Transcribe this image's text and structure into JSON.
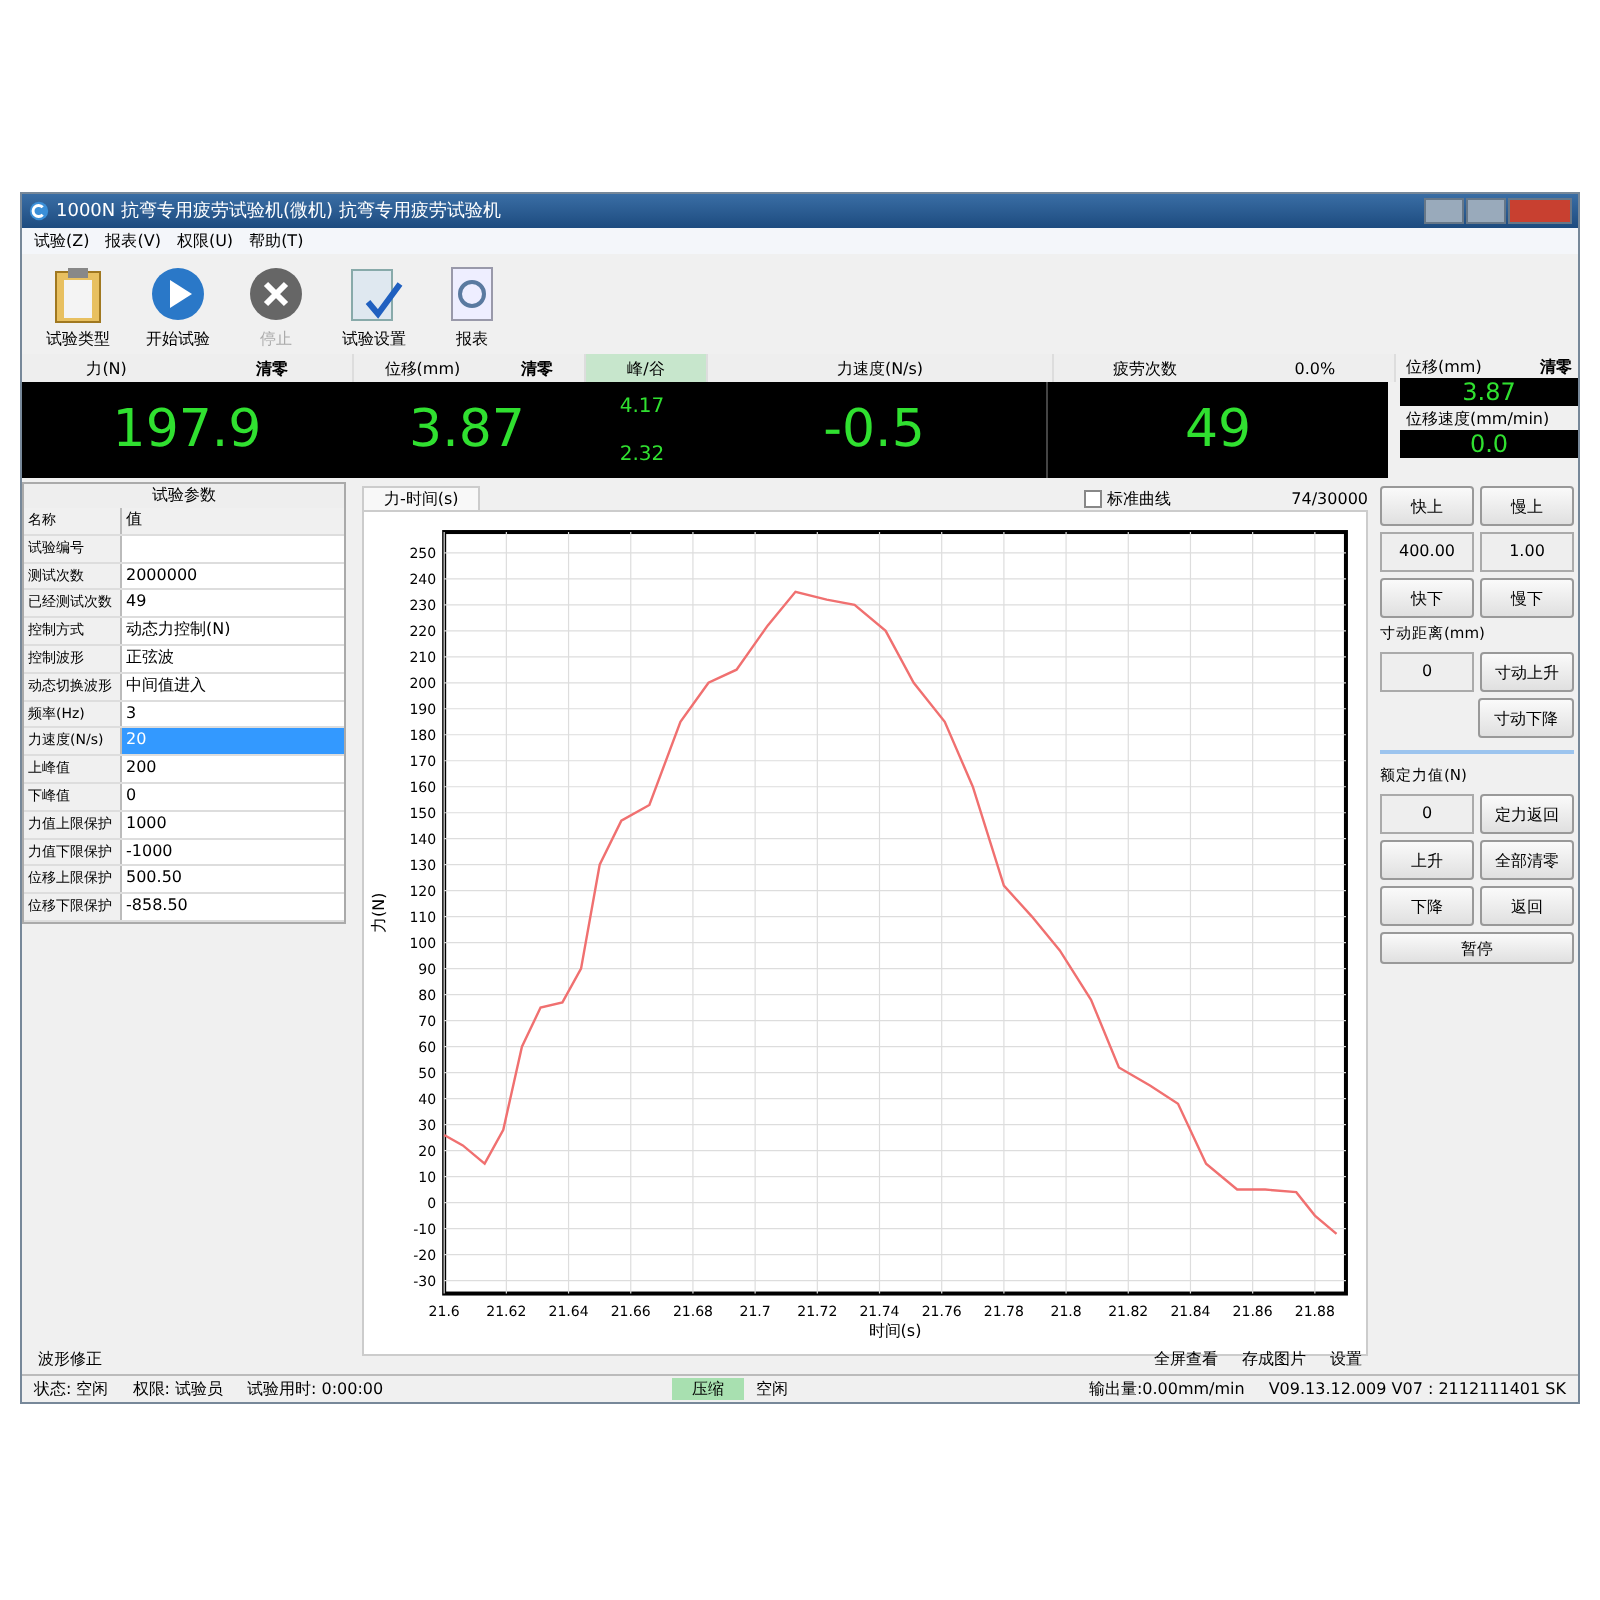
{
  "window": {
    "title": "1000N 抗弯专用疲劳试验机(微机) 抗弯专用疲劳试验机"
  },
  "menu": [
    "试验(Z)",
    "报表(V)",
    "权限(U)",
    "帮助(T)"
  ],
  "toolbar": [
    {
      "label": "试验类型",
      "kind": "clipboard",
      "disabled": false
    },
    {
      "label": "开始试验",
      "kind": "play",
      "disabled": false
    },
    {
      "label": "停止",
      "kind": "stop",
      "disabled": true
    },
    {
      "label": "试验设置",
      "kind": "settings",
      "disabled": false
    },
    {
      "label": "报表",
      "kind": "report",
      "disabled": false
    }
  ],
  "readouts": [
    {
      "label": "力(N)",
      "action": "清零",
      "value": "197.9"
    },
    {
      "label": "位移(mm)",
      "action": "清零",
      "value": "3.87"
    },
    {
      "label": "峰/谷",
      "peak": "4.17",
      "valley": "2.32"
    },
    {
      "label": "力速度(N/s)",
      "value": "-0.5"
    },
    {
      "label": "疲劳次数",
      "percent": "0.0%",
      "value": "49"
    }
  ],
  "side_readouts": [
    {
      "label": "位移(mm)",
      "action": "清零",
      "value": "3.87"
    },
    {
      "label": "位移速度(mm/min)",
      "value": "0.0"
    }
  ],
  "params": {
    "title": "试验参数",
    "columns": [
      "名称",
      "值"
    ],
    "rows": [
      {
        "name": "试验编号",
        "value": "",
        "selected": false
      },
      {
        "name": "测试次数",
        "value": "2000000",
        "selected": false
      },
      {
        "name": "已经测试次数",
        "value": "49",
        "selected": false
      },
      {
        "name": "控制方式",
        "value": "动态力控制(N)",
        "selected": false
      },
      {
        "name": "控制波形",
        "value": "正弦波",
        "selected": false
      },
      {
        "name": "动态切换波形",
        "value": "中间值进入",
        "selected": false
      },
      {
        "name": "频率(Hz)",
        "value": "3",
        "selected": false
      },
      {
        "name": "力速度(N/s)",
        "value": "20",
        "selected": true
      },
      {
        "name": "上峰值",
        "value": "200",
        "selected": false
      },
      {
        "name": "下峰值",
        "value": "0",
        "selected": false
      },
      {
        "name": "力值上限保护",
        "value": "1000",
        "selected": false
      },
      {
        "name": "力值下限保护",
        "value": "-1000",
        "selected": false
      },
      {
        "name": "位移上限保护",
        "value": "500.50",
        "selected": false
      },
      {
        "name": "位移下限保护",
        "value": "-858.50",
        "selected": false
      }
    ]
  },
  "chart_panel": {
    "tab": "力-时间(s)",
    "standard_curve": {
      "label": "标准曲线",
      "checked": false
    },
    "counter": "74/30000",
    "chart_data": {
      "type": "line",
      "grid": true,
      "xlabel": "时间(s)",
      "ylabel": "力(N)",
      "xlim": [
        21.6,
        21.89
      ],
      "ylim": [
        -35,
        258
      ],
      "xticks": [
        21.6,
        21.62,
        21.64,
        21.66,
        21.68,
        21.7,
        21.72,
        21.74,
        21.76,
        21.78,
        21.8,
        21.82,
        21.84,
        21.86,
        21.88
      ],
      "yticks": [
        -30,
        -20,
        -10,
        0,
        10,
        20,
        30,
        40,
        50,
        60,
        70,
        80,
        90,
        100,
        110,
        120,
        130,
        140,
        150,
        160,
        170,
        180,
        190,
        200,
        210,
        220,
        230,
        240,
        250
      ],
      "x": [
        21.6,
        21.606,
        21.613,
        21.619,
        21.625,
        21.631,
        21.638,
        21.644,
        21.65,
        21.657,
        21.666,
        21.676,
        21.685,
        21.694,
        21.704,
        21.713,
        21.723,
        21.732,
        21.742,
        21.751,
        21.761,
        21.77,
        21.78,
        21.789,
        21.798,
        21.808,
        21.817,
        21.827,
        21.836,
        21.845,
        21.855,
        21.864,
        21.874,
        21.88,
        21.887
      ],
      "series": [
        {
          "color": "#f07070",
          "values": [
            26,
            22,
            15,
            28,
            60,
            75,
            77,
            90,
            130,
            147,
            153,
            185,
            200,
            205,
            222,
            235,
            232,
            230,
            220,
            200,
            185,
            160,
            122,
            110,
            97,
            78,
            52,
            45,
            38,
            15,
            5,
            5,
            4,
            -5,
            -12
          ]
        }
      ]
    }
  },
  "controls": [
    {
      "kind": "pair",
      "items": [
        {
          "kind": "button",
          "label": "快上"
        },
        {
          "kind": "button",
          "label": "慢上"
        }
      ]
    },
    {
      "kind": "pair",
      "items": [
        {
          "kind": "field",
          "label": "400.00"
        },
        {
          "kind": "field",
          "label": "1.00"
        }
      ]
    },
    {
      "kind": "pair",
      "items": [
        {
          "kind": "button",
          "label": "快下"
        },
        {
          "kind": "button",
          "label": "慢下"
        }
      ]
    },
    {
      "kind": "caption",
      "label": "寸动距离(mm)"
    },
    {
      "kind": "pair",
      "items": [
        {
          "kind": "field",
          "label": "0"
        },
        {
          "kind": "button",
          "label": "寸动上升"
        }
      ]
    },
    {
      "kind": "pair",
      "items": [
        {
          "kind": "spacer"
        },
        {
          "kind": "button",
          "label": "寸动下降"
        }
      ]
    },
    {
      "kind": "divider"
    },
    {
      "kind": "caption",
      "label": "额定力值(N)"
    },
    {
      "kind": "pair",
      "items": [
        {
          "kind": "field",
          "label": "0"
        },
        {
          "kind": "button",
          "label": "定力返回"
        }
      ]
    },
    {
      "kind": "pair",
      "items": [
        {
          "kind": "button",
          "label": "上升"
        },
        {
          "kind": "button",
          "label": "全部清零"
        }
      ]
    },
    {
      "kind": "pair",
      "items": [
        {
          "kind": "button",
          "label": "下降"
        },
        {
          "kind": "button",
          "label": "返回"
        }
      ]
    },
    {
      "kind": "wide",
      "label": "暂停"
    }
  ],
  "bottom_bar": {
    "left": "波形修正",
    "actions": [
      "全屏查看",
      "存成图片",
      "设置"
    ]
  },
  "status_bar": [
    {
      "text": "状态: 空闲",
      "highlight": false
    },
    {
      "text": "权限: 试验员",
      "highlight": false
    },
    {
      "text": "试验用时: 0:00:00",
      "highlight": false
    },
    {
      "text": "压缩",
      "highlight": true
    },
    {
      "text": "空闲",
      "highlight": false
    },
    {
      "text": "输出量:0.00mm/min",
      "highlight": false
    },
    {
      "text": "V09.13.12.009 V07 : 2112111401 SK",
      "highlight": false
    }
  ]
}
